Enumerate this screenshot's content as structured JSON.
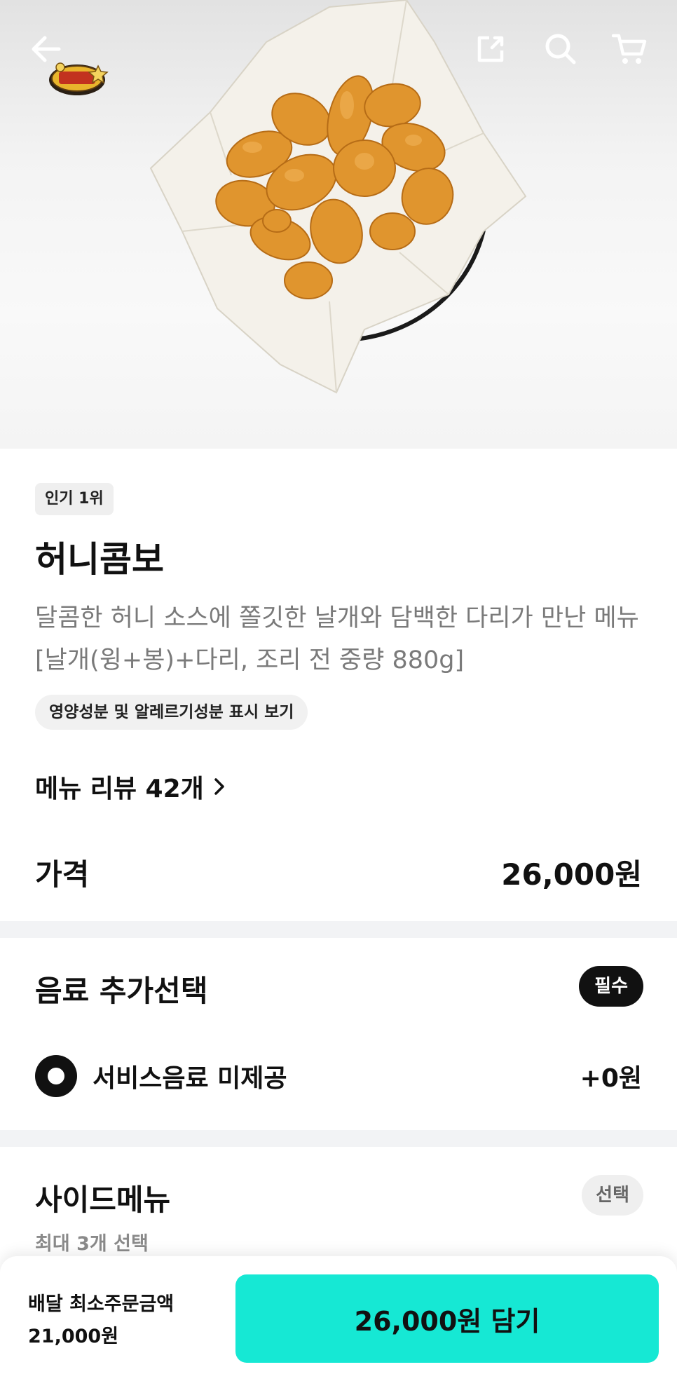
{
  "header": {
    "back_icon": "arrow-left-icon",
    "share_icon": "share-icon",
    "search_icon": "search-icon",
    "cart_icon": "cart-icon",
    "logo_text": "카슐랭 스타"
  },
  "product": {
    "rank_badge": "인기 1위",
    "name": "허니콤보",
    "description": "달콤한 허니 소스에 쫄깃한 날개와 담백한 다리가 만난 메뉴[날개(윙+봉)+다리, 조리 전 중량 880g]",
    "nutrition_link": "영양성분 및 알레르기성분 표시 보기",
    "review_link": "메뉴 리뷰 42개",
    "price_label": "가격",
    "price": "26,000원"
  },
  "drink_group": {
    "title": "음료 추가선택",
    "badge": "필수",
    "options": [
      {
        "label": "서비스음료 미제공",
        "price": "+0원",
        "selected": true
      }
    ]
  },
  "side_group": {
    "title": "사이드메뉴",
    "badge": "선택",
    "subtitle": "최대 3개 선택"
  },
  "bottom_bar": {
    "min_order_label": "배달 최소주문금액",
    "min_order_value": "21,000원",
    "cart_button": "26,000원 담기"
  },
  "colors": {
    "accent": "#16e8d4",
    "divider": "#f2f3f5",
    "muted_text": "#7a7a7a"
  }
}
